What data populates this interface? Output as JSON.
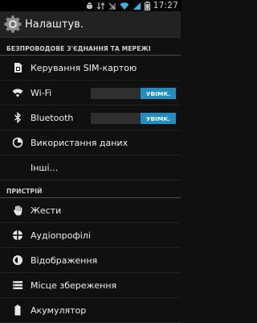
{
  "status_bar": {
    "time": "17:27"
  },
  "action_bar": {
    "title": "Налаштув."
  },
  "sections": {
    "wireless": {
      "header": "БЕЗПРОВОДОВЕ З'ЄДНАННЯ ТА МЕРЕЖІ",
      "items": [
        {
          "label": "Керування SIM-картою",
          "icon": "sim-icon"
        },
        {
          "label": "Wi-Fi",
          "icon": "wifi-icon",
          "toggle": "УВІМК."
        },
        {
          "label": "Bluetooth",
          "icon": "bluetooth-icon",
          "toggle": "УВІМК."
        },
        {
          "label": "Використання даних",
          "icon": "data-usage-icon"
        },
        {
          "label": "Інші…"
        }
      ]
    },
    "device": {
      "header": "ПРИСТРІЙ",
      "items": [
        {
          "label": "Жести",
          "icon": "gesture-hand-icon"
        },
        {
          "label": "Аудіопрофілі",
          "icon": "audio-profiles-icon"
        },
        {
          "label": "Відображення",
          "icon": "display-icon"
        },
        {
          "label": "Місце збереження",
          "icon": "storage-icon"
        },
        {
          "label": "Акумулятор",
          "icon": "battery-icon"
        }
      ]
    }
  },
  "colors": {
    "accent": "#1f8ec0",
    "background": "#101010",
    "action_bar": "#222222"
  }
}
